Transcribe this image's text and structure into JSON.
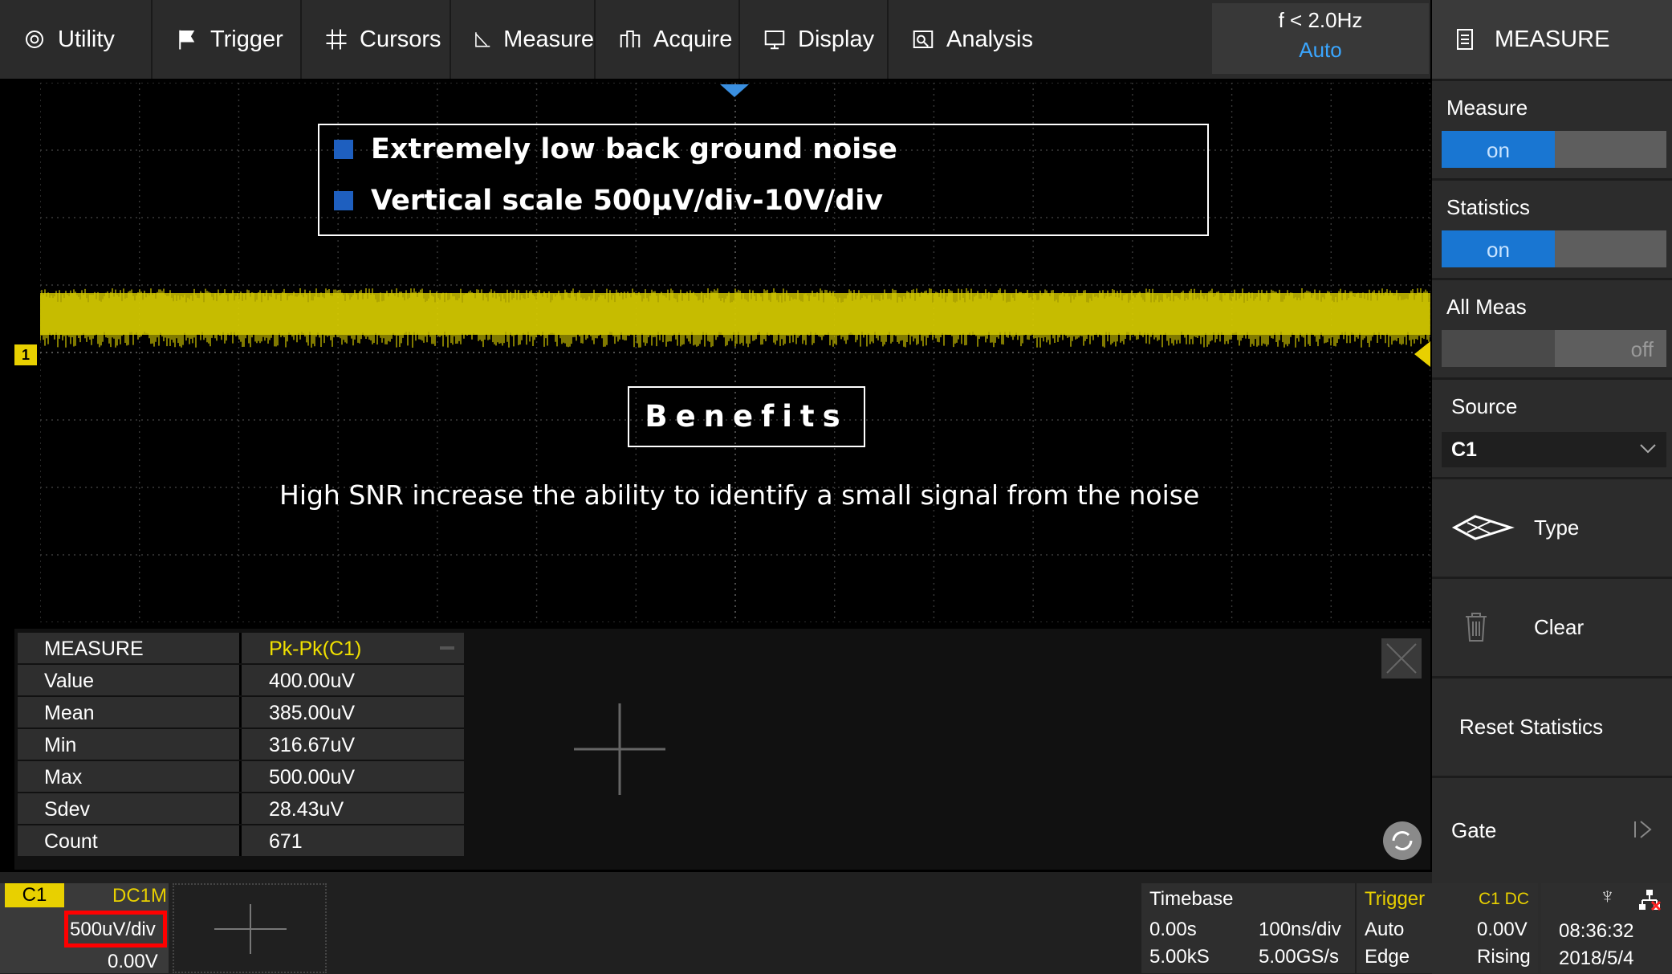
{
  "menu": {
    "items": [
      {
        "label": "Utility",
        "icon": "gear-icon"
      },
      {
        "label": "Trigger",
        "icon": "flag-icon"
      },
      {
        "label": "Cursors",
        "icon": "cursors-icon"
      },
      {
        "label": "Measure",
        "icon": "measure-icon"
      },
      {
        "label": "Acquire",
        "icon": "acquire-icon"
      },
      {
        "label": "Display",
        "icon": "display-icon"
      },
      {
        "label": "Analysis",
        "icon": "analysis-icon"
      }
    ],
    "freq": "f < 2.0Hz",
    "mode": "Auto"
  },
  "panel": {
    "title": "MEASURE",
    "measure_label": "Measure",
    "measure_state": "on",
    "statistics_label": "Statistics",
    "statistics_state": "on",
    "allmeas_label": "All Meas",
    "allmeas_state": "off",
    "source_label": "Source",
    "source_value": "C1",
    "type_label": "Type",
    "clear_label": "Clear",
    "reset_label": "Reset Statistics",
    "gate_label": "Gate"
  },
  "overlay": {
    "bullet1": "Extremely low back ground noise",
    "bullet2": "Vertical scale  500μV/div-10V/div",
    "benefits": "Benefits",
    "snr": "High SNR increase the ability to identify a small signal from the noise"
  },
  "channel_marker": "1",
  "measure_table": {
    "header": {
      "k": "MEASURE",
      "v": "Pk-Pk(C1)"
    },
    "rows": [
      {
        "k": "Value",
        "v": "400.00uV"
      },
      {
        "k": "Mean",
        "v": "385.00uV"
      },
      {
        "k": "Min",
        "v": "316.67uV"
      },
      {
        "k": "Max",
        "v": "500.00uV"
      },
      {
        "k": "Sdev",
        "v": "28.43uV"
      },
      {
        "k": "Count",
        "v": "671"
      }
    ]
  },
  "bottom": {
    "ch": "C1",
    "coupling": "DC1M",
    "scale": "500uV/div",
    "offset": "0.00V",
    "timebase_label": "Timebase",
    "tb_delay": "0.00s",
    "tb_scale": "100ns/div",
    "tb_pts": "5.00kS",
    "tb_rate": "5.00GS/s",
    "trig_label": "Trigger",
    "trig_src": "C1 DC",
    "trig_mode": "Auto",
    "trig_level": "0.00V",
    "trig_type": "Edge",
    "trig_slope": "Rising",
    "time": "08:36:32",
    "date": "2018/5/4"
  },
  "colors": {
    "accent": "#1976d2",
    "trace": "#e0d400",
    "highlight": "#ff0000"
  }
}
